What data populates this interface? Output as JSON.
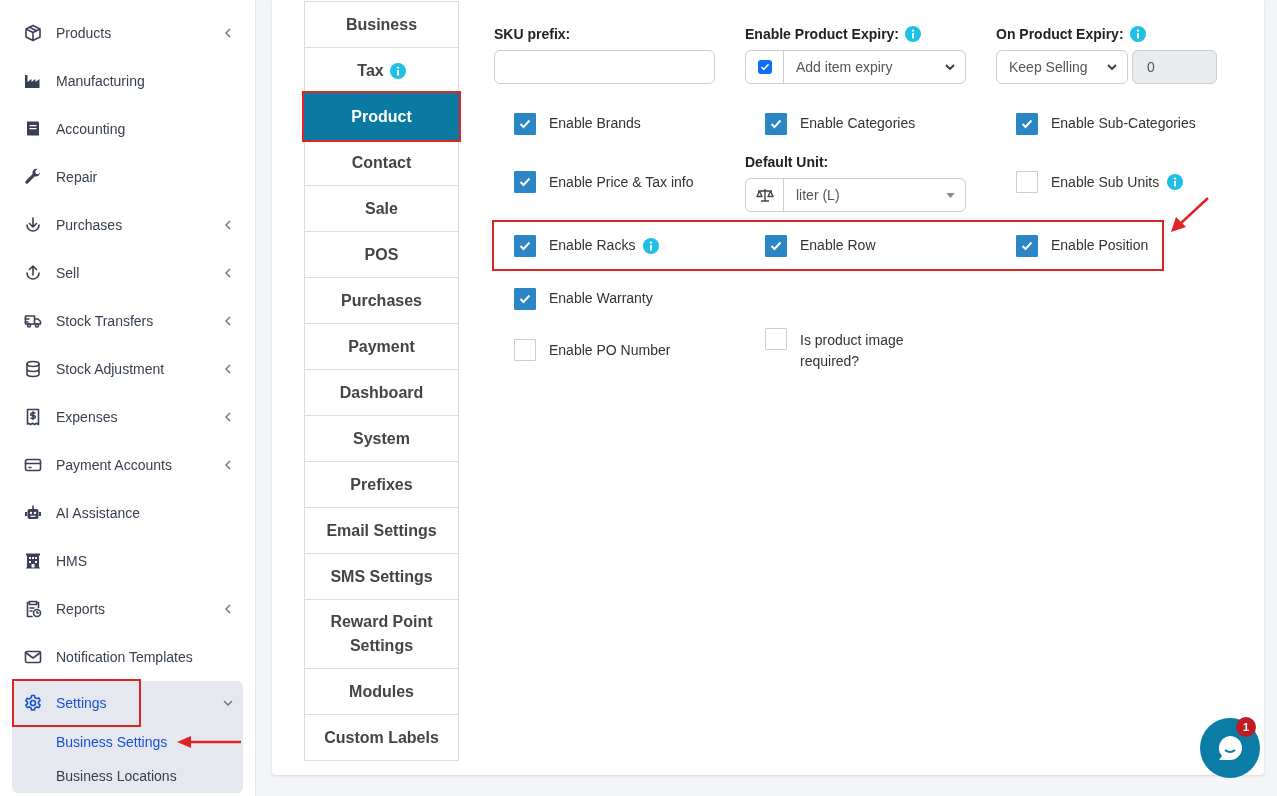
{
  "sidebar": {
    "items": [
      {
        "label": "Products",
        "submenu": true,
        "expanded": false,
        "highlighted": false
      },
      {
        "label": "Manufacturing",
        "submenu": false,
        "expanded": false,
        "highlighted": false
      },
      {
        "label": "Accounting",
        "submenu": false,
        "expanded": false,
        "highlighted": false
      },
      {
        "label": "Repair",
        "submenu": false,
        "expanded": false,
        "highlighted": false
      },
      {
        "label": "Purchases",
        "submenu": true,
        "expanded": false,
        "highlighted": false
      },
      {
        "label": "Sell",
        "submenu": true,
        "expanded": false,
        "highlighted": false
      },
      {
        "label": "Stock Transfers",
        "submenu": true,
        "expanded": false,
        "highlighted": false
      },
      {
        "label": "Stock Adjustment",
        "submenu": true,
        "expanded": false,
        "highlighted": false
      },
      {
        "label": "Expenses",
        "submenu": true,
        "expanded": false,
        "highlighted": false
      },
      {
        "label": "Payment Accounts",
        "submenu": true,
        "expanded": false,
        "highlighted": false
      },
      {
        "label": "AI Assistance",
        "submenu": false,
        "expanded": false,
        "highlighted": false
      },
      {
        "label": "HMS",
        "submenu": false,
        "expanded": false,
        "highlighted": false
      },
      {
        "label": "Reports",
        "submenu": true,
        "expanded": false,
        "highlighted": false
      },
      {
        "label": "Notification Templates",
        "submenu": false,
        "expanded": false,
        "highlighted": false
      },
      {
        "label": "Settings",
        "submenu": true,
        "expanded": true,
        "highlighted": true,
        "children": [
          {
            "label": "Business Settings",
            "selected": true,
            "pointer_arrow": true
          },
          {
            "label": "Business Locations",
            "selected": false,
            "pointer_arrow": false
          }
        ]
      }
    ]
  },
  "tabs": [
    {
      "label": "Business",
      "selected": false,
      "info": false,
      "highlighted": false
    },
    {
      "label": "Tax",
      "selected": false,
      "info": true,
      "highlighted": false
    },
    {
      "label": "Product",
      "selected": true,
      "info": false,
      "highlighted": true
    },
    {
      "label": "Contact",
      "selected": false,
      "info": false,
      "highlighted": false
    },
    {
      "label": "Sale",
      "selected": false,
      "info": false,
      "highlighted": false
    },
    {
      "label": "POS",
      "selected": false,
      "info": false,
      "highlighted": false
    },
    {
      "label": "Purchases",
      "selected": false,
      "info": false,
      "highlighted": false
    },
    {
      "label": "Payment",
      "selected": false,
      "info": false,
      "highlighted": false
    },
    {
      "label": "Dashboard",
      "selected": false,
      "info": false,
      "highlighted": false
    },
    {
      "label": "System",
      "selected": false,
      "info": false,
      "highlighted": false
    },
    {
      "label": "Prefixes",
      "selected": false,
      "info": false,
      "highlighted": false
    },
    {
      "label": "Email Settings",
      "selected": false,
      "info": false,
      "highlighted": false
    },
    {
      "label": "SMS Settings",
      "selected": false,
      "info": false,
      "highlighted": false
    },
    {
      "label": "Reward Point Settings",
      "selected": false,
      "info": false,
      "highlighted": false
    },
    {
      "label": "Modules",
      "selected": false,
      "info": false,
      "highlighted": false
    },
    {
      "label": "Custom Labels",
      "selected": false,
      "info": false,
      "highlighted": false
    }
  ],
  "form": {
    "top": [
      {
        "kind": "text",
        "label": "SKU prefix:",
        "info": false
      },
      {
        "kind": "check_select",
        "label": "Enable Product Expiry:",
        "info": true,
        "checked": true,
        "value": "Add item expiry"
      },
      {
        "kind": "select_number",
        "label": "On Product Expiry:",
        "info": true,
        "value": "Keep Selling",
        "number": "0"
      }
    ],
    "rows": [
      {
        "highlighted": false,
        "pointer_arrow": false,
        "cells": [
          {
            "kind": "checkbox",
            "label": "Enable Brands",
            "checked": true,
            "info": false
          },
          {
            "kind": "checkbox",
            "label": "Enable Categories",
            "checked": true,
            "info": false
          },
          {
            "kind": "checkbox",
            "label": "Enable Sub-Categories",
            "checked": true,
            "info": false
          }
        ]
      },
      {
        "highlighted": false,
        "pointer_arrow": false,
        "cells": [
          {
            "kind": "checkbox",
            "label": "Enable Price & Tax info",
            "checked": true,
            "info": false
          },
          {
            "kind": "unit_select",
            "label": "Default Unit:",
            "value": "liter (L)"
          },
          {
            "kind": "checkbox",
            "label": "Enable Sub Units",
            "checked": false,
            "info": true
          }
        ]
      },
      {
        "highlighted": true,
        "pointer_arrow": true,
        "cells": [
          {
            "kind": "checkbox",
            "label": "Enable Racks",
            "checked": true,
            "info": true
          },
          {
            "kind": "checkbox",
            "label": "Enable Row",
            "checked": true,
            "info": false
          },
          {
            "kind": "checkbox",
            "label": "Enable Position",
            "checked": true,
            "info": false
          }
        ]
      },
      {
        "highlighted": false,
        "pointer_arrow": false,
        "cells": [
          {
            "kind": "checkbox",
            "label": "Enable Warranty",
            "checked": true,
            "info": false
          }
        ]
      },
      {
        "highlighted": false,
        "pointer_arrow": false,
        "cells": [
          {
            "kind": "checkbox",
            "label": "Enable PO Number",
            "checked": false,
            "info": false
          },
          {
            "kind": "checkbox_wrap",
            "label": "Is product image required?",
            "checked": false,
            "info": false
          }
        ]
      }
    ]
  },
  "chat": {
    "badge": "1"
  }
}
